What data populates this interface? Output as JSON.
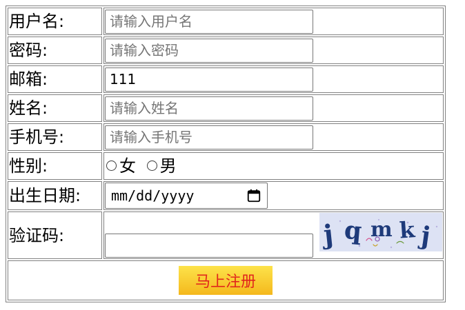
{
  "form": {
    "username": {
      "label": "用户名:",
      "placeholder": "请输入用户名",
      "value": ""
    },
    "password": {
      "label": "密码:",
      "placeholder": "请输入密码",
      "value": ""
    },
    "email": {
      "label": "邮箱:",
      "placeholder": "",
      "value": "111"
    },
    "name": {
      "label": "姓名:",
      "placeholder": "请输入姓名",
      "value": ""
    },
    "phone": {
      "label": "手机号:",
      "placeholder": "请输入手机号",
      "value": ""
    },
    "gender": {
      "label": "性别:",
      "options": [
        "女",
        "男"
      ],
      "selected": null
    },
    "birthdate": {
      "label": "出生日期:",
      "placeholder": "mm/dd/yyyy",
      "icon": "calendar-icon"
    },
    "captcha": {
      "label": "验证码:",
      "value": "",
      "image_text": "jqmkj"
    },
    "submit": {
      "label": "马上注册"
    }
  },
  "colors": {
    "border": "#808080",
    "submit_bg_top": "#fde34a",
    "submit_bg_bottom": "#f4b81d",
    "submit_text": "#e1261c",
    "captcha_bg": "#dde2f4",
    "captcha_ink": "#1e3a7a"
  }
}
